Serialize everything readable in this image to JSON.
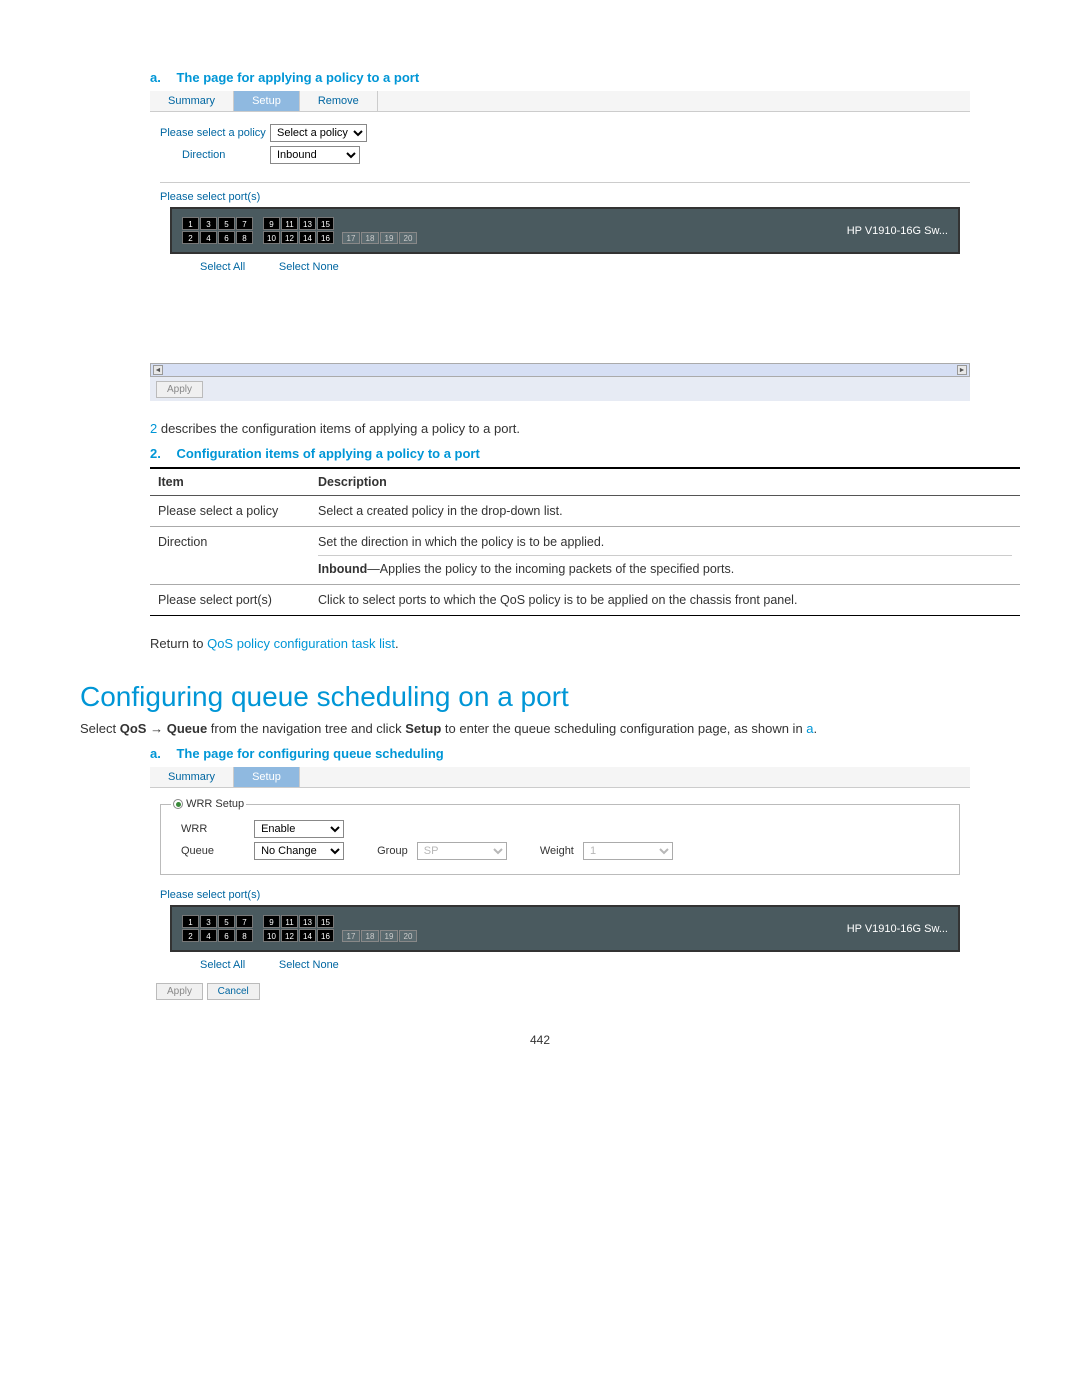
{
  "caption_a": {
    "letter": "a.",
    "text": "The page for applying a policy to a port"
  },
  "ui_a": {
    "tabs": [
      "Summary",
      "Setup",
      "Remove"
    ],
    "active_tab": 1,
    "policy_label": "Please select a policy",
    "policy_value": "Select a policy",
    "direction_label": "Direction",
    "direction_value": "Inbound",
    "ports_label": "Please select port(s)",
    "switch_model": "HP V1910-16G Sw...",
    "ports_top": [
      "1",
      "3",
      "5",
      "7",
      "9",
      "11",
      "13",
      "15"
    ],
    "ports_bottom": [
      "2",
      "4",
      "6",
      "8",
      "10",
      "12",
      "14",
      "16"
    ],
    "ports_flat": [
      "17",
      "18",
      "19",
      "20"
    ],
    "select_all": "Select All",
    "select_none": "Select None",
    "apply": "Apply"
  },
  "body1_prefix": "2",
  "body1_text": " describes the configuration items of applying a policy to a port.",
  "caption_2": {
    "num": "2.",
    "text": "Configuration items of applying a policy to a port"
  },
  "table": {
    "headers": [
      "Item",
      "Description"
    ],
    "rows": [
      {
        "item": "Please select a policy",
        "desc": "Select a created policy in the drop-down list."
      },
      {
        "item": "Direction",
        "desc_line1": "Set the direction in which the policy is to be applied.",
        "desc_bold": "Inbound",
        "desc_after": "—Applies the policy to the incoming packets of the specified ports."
      },
      {
        "item": "Please select port(s)",
        "desc": "Click to select ports to which the QoS policy is to be applied on the chassis front panel."
      }
    ]
  },
  "return_text": "Return to ",
  "return_link": "QoS policy configuration task list",
  "return_period": ".",
  "h1": "Configuring queue scheduling on a port",
  "body2_pre": "Select ",
  "body2_b1": "QoS",
  "body2_arrow": " → ",
  "body2_b2": "Queue",
  "body2_mid": " from the navigation tree and click ",
  "body2_b3": "Setup",
  "body2_post": " to enter the queue scheduling configuration page, as shown in ",
  "body2_link": "a",
  "body2_end": ".",
  "caption_b": {
    "letter": "a.",
    "text": "The page for configuring queue scheduling"
  },
  "ui_b": {
    "tabs": [
      "Summary",
      "Setup"
    ],
    "active_tab": 1,
    "fieldset_label": "WRR Setup",
    "wrr_label": "WRR",
    "wrr_value": "Enable",
    "queue_label": "Queue",
    "queue_value": "No Change",
    "group_label": "Group",
    "group_value": "SP",
    "weight_label": "Weight",
    "weight_value": "1",
    "ports_label": "Please select port(s)",
    "switch_model": "HP V1910-16G Sw...",
    "ports_top": [
      "1",
      "3",
      "5",
      "7",
      "9",
      "11",
      "13",
      "15"
    ],
    "ports_bottom": [
      "2",
      "4",
      "6",
      "8",
      "10",
      "12",
      "14",
      "16"
    ],
    "ports_flat": [
      "17",
      "18",
      "19",
      "20"
    ],
    "select_all": "Select All",
    "select_none": "Select None",
    "apply": "Apply",
    "cancel": "Cancel"
  },
  "page_num": "442"
}
